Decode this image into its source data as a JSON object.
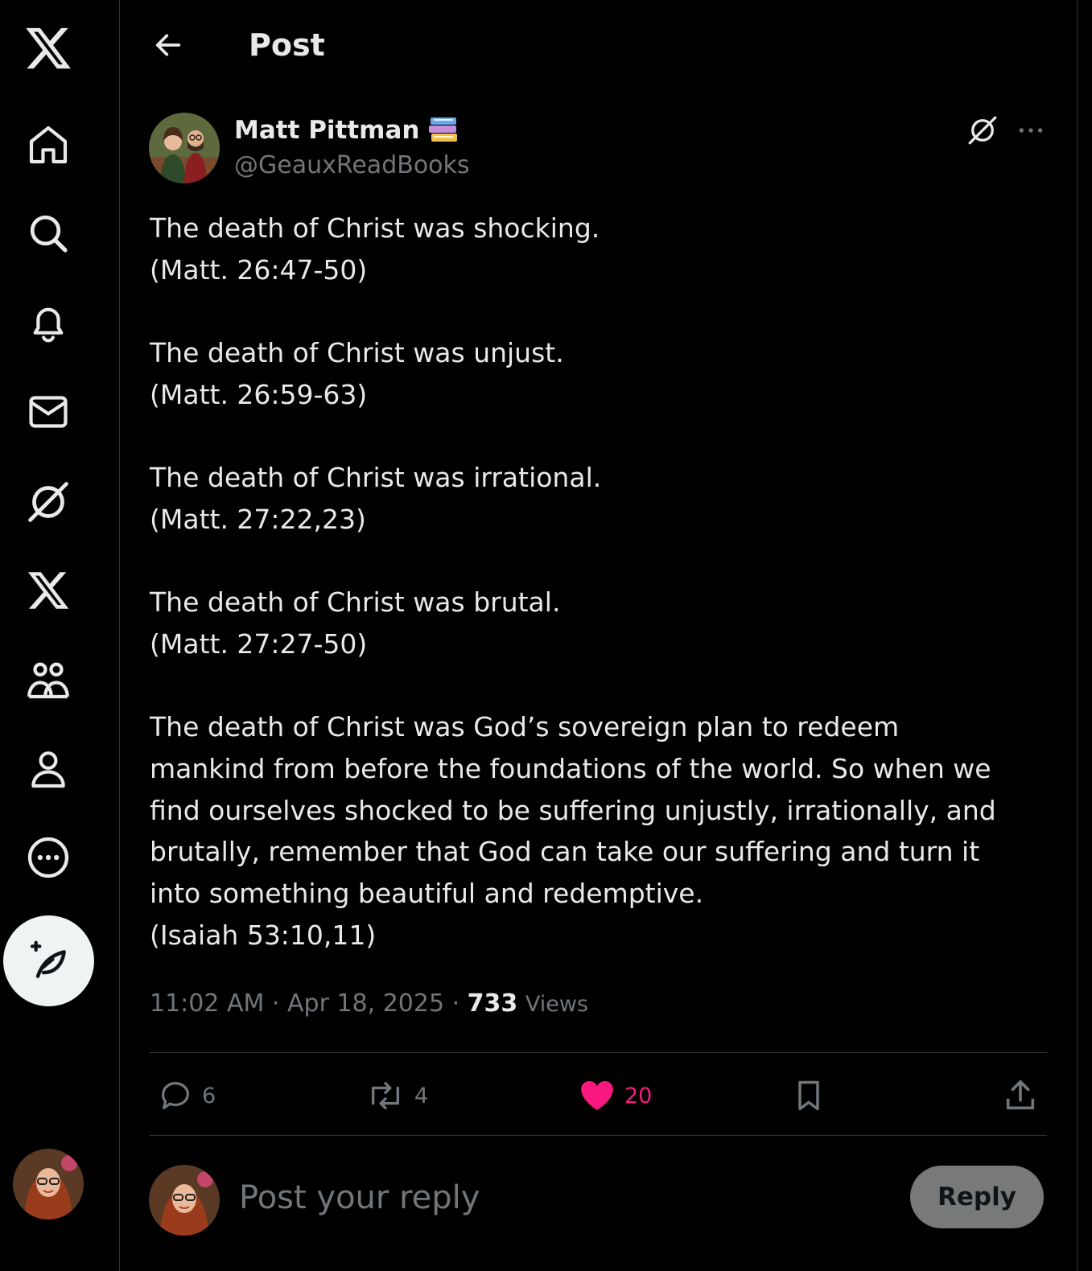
{
  "header": {
    "title": "Post"
  },
  "sidebar": {
    "items": [
      {
        "icon": "x-logo-icon"
      },
      {
        "icon": "home-icon"
      },
      {
        "icon": "search-icon"
      },
      {
        "icon": "bell-icon"
      },
      {
        "icon": "mail-icon"
      },
      {
        "icon": "grok-icon"
      },
      {
        "icon": "x-premium-icon"
      },
      {
        "icon": "communities-icon"
      },
      {
        "icon": "profile-icon"
      },
      {
        "icon": "more-circle-icon"
      }
    ],
    "compose_icon": "compose-feather-icon"
  },
  "post": {
    "author": {
      "name": "Matt Pittman",
      "handle": "@GeauxReadBooks",
      "badge_icon": "books-emoji-icon"
    },
    "lines": [
      "The death of Christ was shocking.",
      "(Matt. 26:47-50)",
      "",
      "The death of Christ was unjust.",
      "(Matt. 26:59-63)",
      "",
      "The death of Christ was irrational.",
      "(Matt. 27:22,23)",
      "",
      "The death of Christ was brutal.",
      "(Matt. 27:27-50)",
      "",
      "The death of Christ was God’s sovereign plan to redeem",
      "mankind from before the foundations of the world. So when we",
      "find ourselves shocked to be suffering unjustly, irrationally, and",
      "brutally, remember that God can take our suffering and turn it",
      "into something beautiful and redemptive.",
      "(Isaiah 53:10,11)"
    ],
    "timestamp": "11:02 AM · Apr 18, 2025 · ",
    "views_count": "733",
    "views_label": "Views"
  },
  "actions": {
    "replies": "6",
    "reposts": "4",
    "likes": "20",
    "liked": true,
    "accent_like": "#f91880"
  },
  "reply_box": {
    "placeholder": "Post your reply",
    "button_label": "Reply"
  },
  "colors": {
    "background": "#000000",
    "text": "#e7e9ea",
    "muted": "#71767b",
    "border": "#2f3336"
  }
}
